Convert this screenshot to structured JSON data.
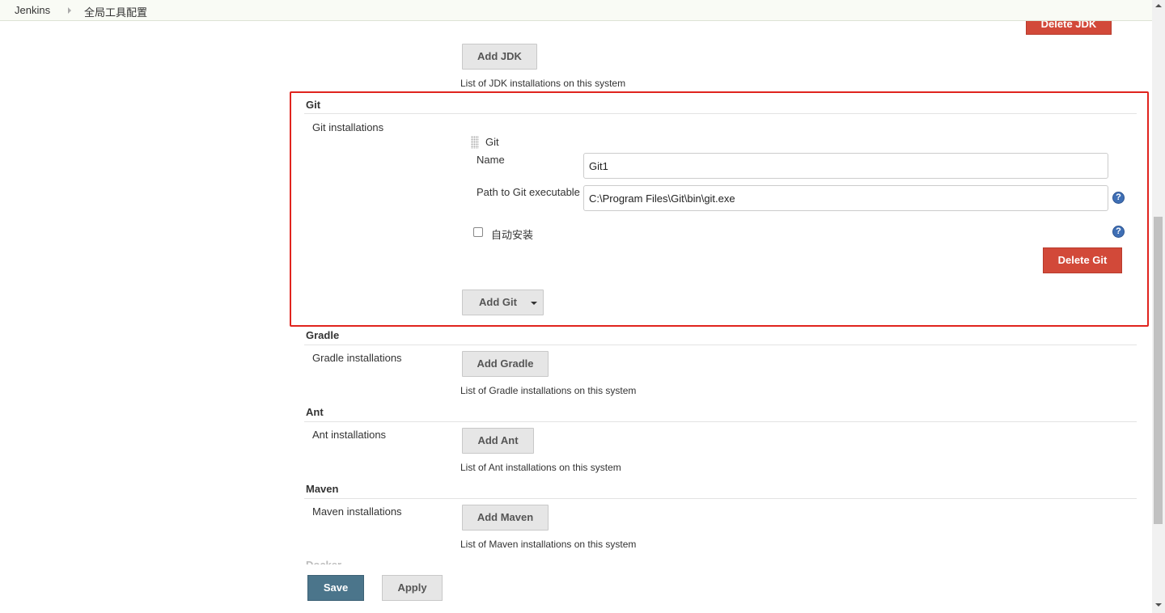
{
  "breadcrumb": {
    "home": "Jenkins",
    "current": "全局工具配置"
  },
  "jdk": {
    "delete_label": "Delete JDK",
    "add_label": "Add JDK",
    "help": "List of JDK installations on this system"
  },
  "git": {
    "section_title": "Git",
    "installations_label": "Git installations",
    "item_title": "Git",
    "name_label": "Name",
    "name_value": "Git1",
    "path_label": "Path to Git executable",
    "path_value": "C:\\Program Files\\Git\\bin\\git.exe",
    "auto_install_label": "自动安装",
    "auto_install_checked": false,
    "delete_label": "Delete Git",
    "add_label": "Add Git"
  },
  "gradle": {
    "section_title": "Gradle",
    "installations_label": "Gradle installations",
    "add_label": "Add Gradle",
    "help": "List of Gradle installations on this system"
  },
  "ant": {
    "section_title": "Ant",
    "installations_label": "Ant installations",
    "add_label": "Add Ant",
    "help": "List of Ant installations on this system"
  },
  "maven": {
    "section_title": "Maven",
    "installations_label": "Maven installations",
    "add_label": "Add Maven",
    "help": "List of Maven installations on this system"
  },
  "footer": {
    "save_label": "Save",
    "apply_label": "Apply",
    "next_section_partial": "Docker"
  },
  "help_icon_glyph": "?",
  "colors": {
    "delete_red": "#d24939",
    "save_blue": "#4b758b",
    "highlight": "#e0241e",
    "help_blue": "#3f6fb5"
  }
}
